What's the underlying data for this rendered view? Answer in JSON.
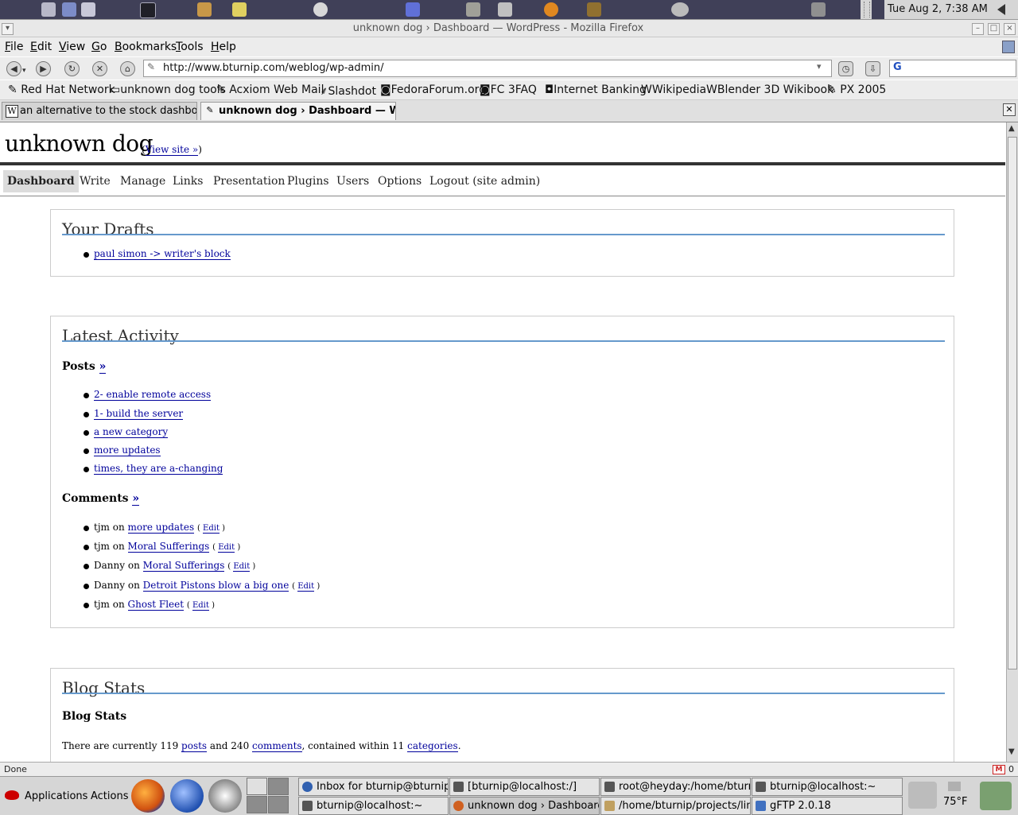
{
  "top_panel": {
    "clock": "Tue Aug  2,  7:38 AM",
    "launcher_icons": [
      "desktop-icon",
      "files-icon",
      "browser-icon",
      "terminal-icon",
      "archive-icon",
      "gimp-icon",
      "ghost-icon",
      "notes-icon",
      "edit-icon",
      "book-icon",
      "blender-icon",
      "inkscape-icon",
      "face-icon",
      "camera-icon"
    ]
  },
  "window": {
    "title": "unknown dog › Dashboard — WordPress - Mozilla Firefox"
  },
  "menubar": [
    "File",
    "Edit",
    "View",
    "Go",
    "Bookmarks",
    "Tools",
    "Help"
  ],
  "navbar": {
    "url": "http://www.bturnip.com/weblog/wp-admin/",
    "search_engine_label": "G"
  },
  "bookmarks": [
    "Red Hat Network",
    "unknown dog tools",
    "Acxiom Web Mail",
    "Slashdot",
    "FedoraForum.org",
    "FC 3FAQ",
    "Internet Banking",
    "Wikipedia",
    "Blender 3D Wikibook",
    "PX 2005"
  ],
  "tabs": [
    {
      "label": "an alternative to the stock dashboa...",
      "active": false
    },
    {
      "label": "unknown dog › Dashboard — Wo...",
      "active": true
    }
  ],
  "page": {
    "site_title": "unknown dog",
    "view_site_link": "View site »",
    "menu": [
      "Dashboard",
      "Write",
      "Manage",
      "Links",
      "Presentation",
      "Plugins",
      "Users",
      "Options",
      "Logout (site admin)"
    ],
    "drafts": {
      "heading": "Your Drafts",
      "items": [
        "paul simon -> writer's block"
      ]
    },
    "activity": {
      "heading": "Latest Activity",
      "posts_heading": "Posts",
      "more_link": "»",
      "posts": [
        "2- enable remote access",
        "1- build the server",
        "a new category",
        "more updates",
        "times, they are a-changing"
      ],
      "comments_heading": "Comments",
      "on_word": "on",
      "edit_label": "Edit",
      "comments": [
        {
          "author": "tjm",
          "post": "more updates"
        },
        {
          "author": "tjm",
          "post": "Moral Sufferings"
        },
        {
          "author": "Danny",
          "post": "Moral Sufferings"
        },
        {
          "author": "Danny",
          "post": "Detroit Pistons blow a big one"
        },
        {
          "author": "tjm",
          "post": "Ghost Fleet"
        }
      ]
    },
    "stats": {
      "heading": "Blog Stats",
      "subheading": "Blog Stats",
      "text_prefix": "There are currently ",
      "posts_count": "119",
      "posts_link": "posts",
      "and_word": " and ",
      "comments_count": "240",
      "comments_link": "comments",
      "contained_text": ", contained within ",
      "categories_count": "11",
      "categories_link": "categories",
      "period": "."
    }
  },
  "statusbar": {
    "status": "Done",
    "mail_count": "0"
  },
  "bottom_panel": {
    "applications": "Applications",
    "actions": "Actions",
    "tasks": [
      "Inbox for bturnip@bturnip.co",
      "[bturnip@localhost:/]",
      "root@heyday:/home/bturnip/",
      "bturnip@localhost:~",
      "bturnip@localhost:~",
      "unknown dog › Dashboard –",
      "/home/bturnip/projects/linux_",
      "gFTP 2.0.18"
    ],
    "weather_temp": "75°F"
  }
}
